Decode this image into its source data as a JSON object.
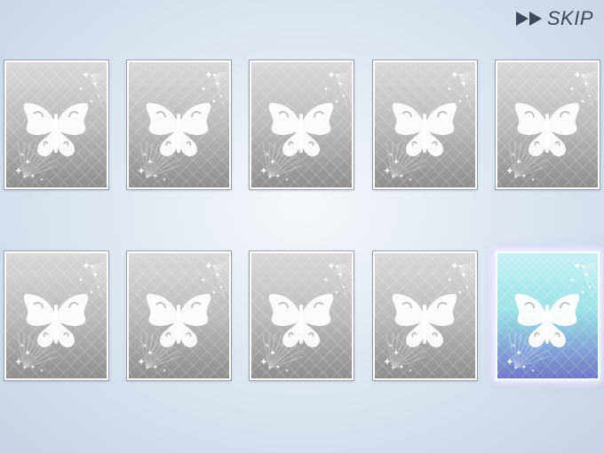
{
  "skip": {
    "label": "SKIP",
    "icon": "fast-forward-icon"
  },
  "cards": [
    {
      "row": 1,
      "col": 1,
      "rarity": "silver",
      "emblem": "butterfly-icon",
      "face": "back"
    },
    {
      "row": 1,
      "col": 2,
      "rarity": "silver",
      "emblem": "butterfly-icon",
      "face": "back"
    },
    {
      "row": 1,
      "col": 3,
      "rarity": "silver",
      "emblem": "butterfly-icon",
      "face": "back"
    },
    {
      "row": 1,
      "col": 4,
      "rarity": "silver",
      "emblem": "butterfly-icon",
      "face": "back"
    },
    {
      "row": 1,
      "col": 5,
      "rarity": "silver",
      "emblem": "butterfly-icon",
      "face": "back"
    },
    {
      "row": 2,
      "col": 1,
      "rarity": "silver",
      "emblem": "butterfly-icon",
      "face": "back"
    },
    {
      "row": 2,
      "col": 2,
      "rarity": "silver",
      "emblem": "butterfly-icon",
      "face": "back"
    },
    {
      "row": 2,
      "col": 3,
      "rarity": "silver",
      "emblem": "butterfly-icon",
      "face": "back"
    },
    {
      "row": 2,
      "col": 4,
      "rarity": "silver",
      "emblem": "butterfly-icon",
      "face": "back"
    },
    {
      "row": 2,
      "col": 5,
      "rarity": "rainbow",
      "emblem": "butterfly-icon",
      "face": "back"
    }
  ],
  "colors": {
    "silver_light": "#d9d9d9",
    "silver_dark": "#8f8f8f",
    "rainbow_top": "#c7f0f0",
    "rainbow_mid": "#9ee3e8",
    "rainbow_bottom": "#6f79c8",
    "skip_text": "#3c4a5a"
  }
}
